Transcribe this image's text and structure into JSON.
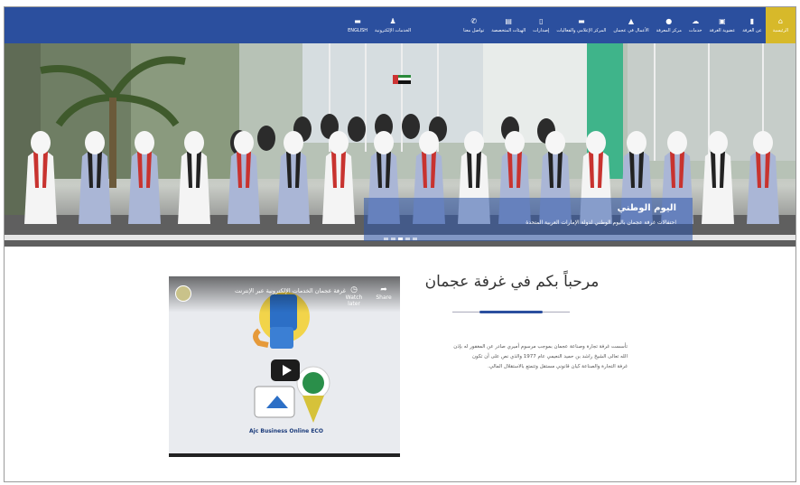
{
  "nav": {
    "items": [
      {
        "label": "الرئيسية",
        "icon": "home-icon",
        "glyph": "⌂",
        "active": true
      },
      {
        "label": "عن الغرفة",
        "icon": "building-icon",
        "glyph": "▮"
      },
      {
        "label": "عضوية الغرفة",
        "icon": "id-card-icon",
        "glyph": "▣"
      },
      {
        "label": "خدمات",
        "icon": "cloud-icon",
        "glyph": "☁"
      },
      {
        "label": "مركز المعرفة",
        "icon": "map-pin-icon",
        "glyph": "●"
      },
      {
        "label": "الأعمال في عجمان",
        "icon": "people-icon",
        "glyph": "▲"
      },
      {
        "label": "المركز الإعلامي والفعاليات",
        "icon": "screen-icon",
        "glyph": "▬"
      },
      {
        "label": "إصدارات",
        "icon": "book-icon",
        "glyph": "▯"
      },
      {
        "label": "الهيئات المتخصصة",
        "icon": "sitemap-icon",
        "glyph": "▤"
      },
      {
        "label": "تواصل معنا",
        "icon": "phone-icon",
        "glyph": "✆"
      }
    ],
    "extra": [
      {
        "label": "الخدمات الإلكترونية",
        "icon": "user-icon",
        "glyph": "♟"
      },
      {
        "label": "ENGLISH",
        "icon": "globe-icon",
        "glyph": "▬"
      }
    ]
  },
  "hero": {
    "title": "اليوم الوطني",
    "subtitle": "احتفالات غرفة عجمان باليوم الوطني لدولة الإمارات العربية المتحدة"
  },
  "welcome": {
    "title": "مرحباً بكم في غرفة عجمان",
    "lines": [
      "تأسست غرفة تجارة وصناعة عجمان بموجب مرسوم أميري صادر عن المغفور له بإذن",
      "الله تعالى الشيخ راشد بن حميد النعيمي عام 1977 والذي نص على أن تكون",
      "غرفة التجارة والصناعة كيان قانوني مستقل وتتمتع بالاستقلال المالي."
    ]
  },
  "video": {
    "title": "غرفة عجمان الخدمات الإلكترونية عبر الإنترنت",
    "watch_later": "Watch later",
    "share": "Share",
    "caption": "Ajc Business Online ECO"
  },
  "colors": {
    "nav": "#2b4f9e",
    "active": "#d7b92a"
  }
}
